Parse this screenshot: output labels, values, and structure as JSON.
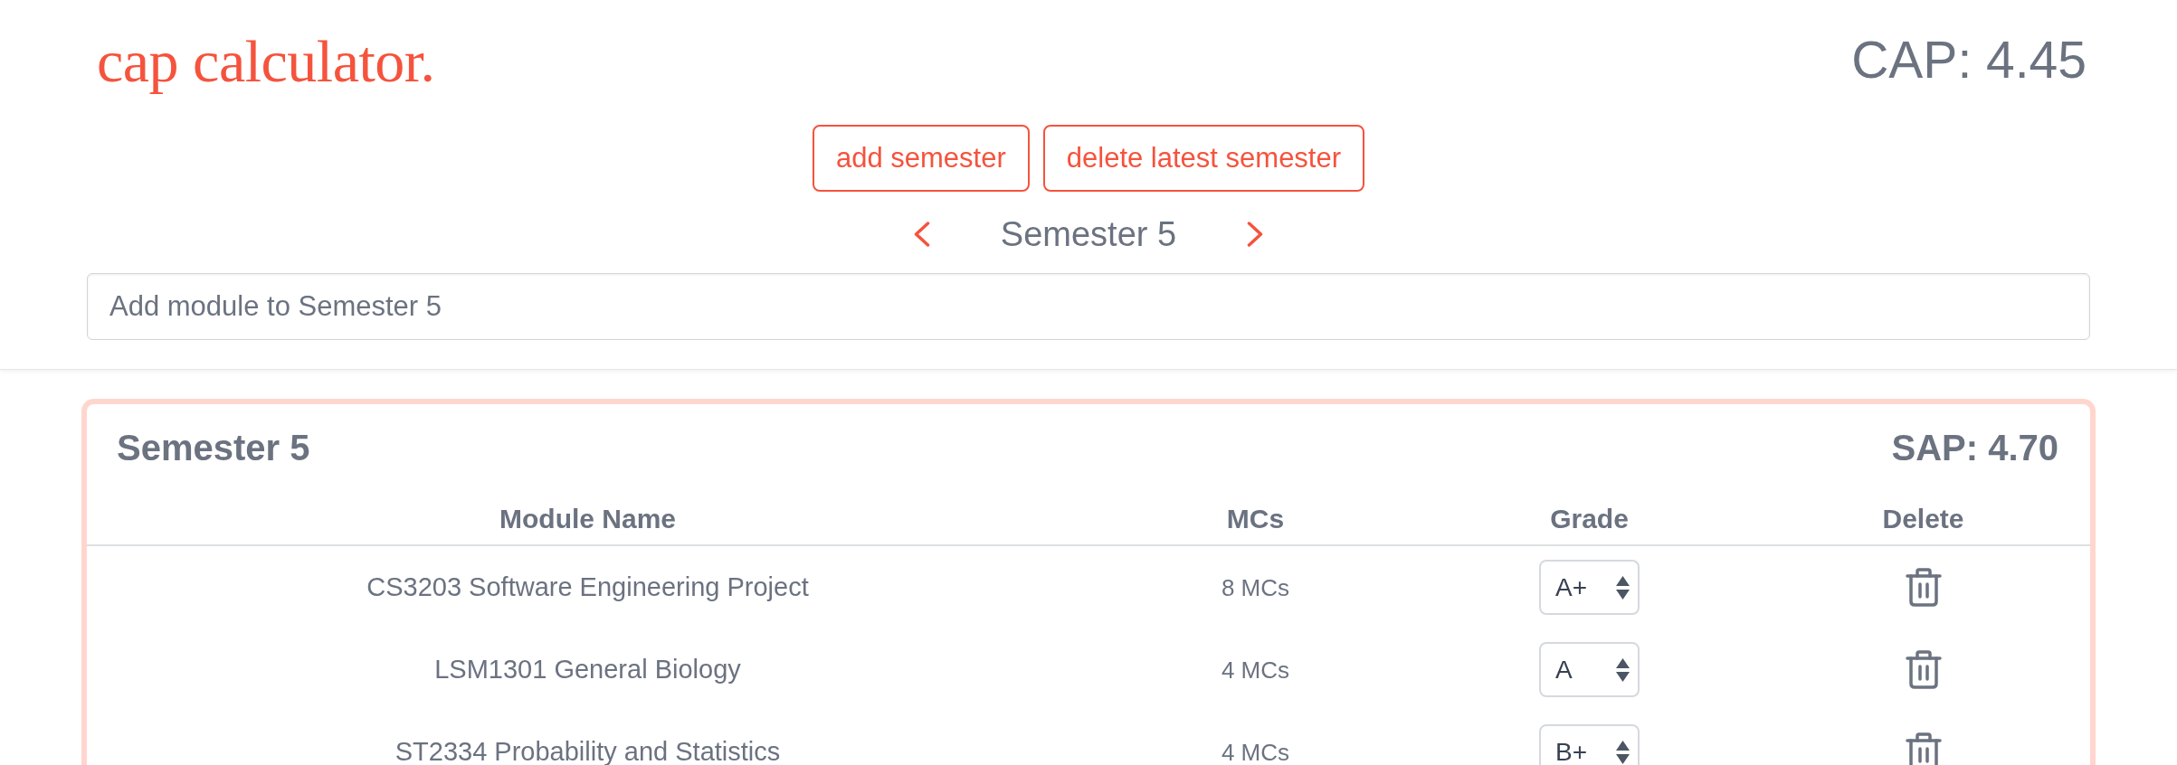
{
  "header": {
    "logo": "cap calculator.",
    "cap": "CAP: 4.45"
  },
  "buttons": [
    "add semester",
    "delete latest semester"
  ],
  "semester_nav": {
    "label": "Semester 5"
  },
  "module_field": {
    "placeholder": "Add module to Semester 5"
  },
  "semester_card": {
    "title": "Semester 5",
    "sap": "SAP: 4.70",
    "columns": [
      "Module Name",
      "MCs",
      "Grade",
      "Delete"
    ],
    "rows": [
      {
        "module": "CS3203 Software Engineering Project",
        "mcs": "8 MCs",
        "grade": "A+"
      },
      {
        "module": "LSM1301 General Biology",
        "mcs": "4 MCs",
        "grade": "A"
      },
      {
        "module": "ST2334 Probability and Statistics",
        "mcs": "4 MCs",
        "grade": "B+"
      }
    ]
  }
}
